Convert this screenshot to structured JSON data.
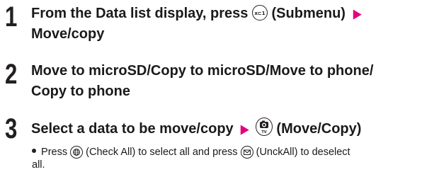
{
  "steps": [
    {
      "number": "1",
      "line1_a": "From the Data list display, press",
      "line1_b": "(Submenu)",
      "line2": "Move/copy"
    },
    {
      "number": "2",
      "line1": "Move to microSD/Copy to microSD/Move to phone/",
      "line2": "Copy to phone"
    },
    {
      "number": "3",
      "line1_a": "Select a data to be move/copy",
      "line1_b": "(Move/Copy)",
      "note_a": "Press",
      "note_b": "(Check All) to select all and press",
      "note_c": "(UnckAll) to deselect",
      "note_d": "all."
    }
  ],
  "icons": {
    "submenu_key": "submenu-key-icon",
    "camera_tv_key": "camera-tv-key-icon",
    "globe_key": "globe-key-icon",
    "mail_key": "mail-key-icon",
    "arrow": "triangle-right-icon"
  },
  "colors": {
    "arrow": "#e5007e",
    "text": "#1a1a1a"
  }
}
